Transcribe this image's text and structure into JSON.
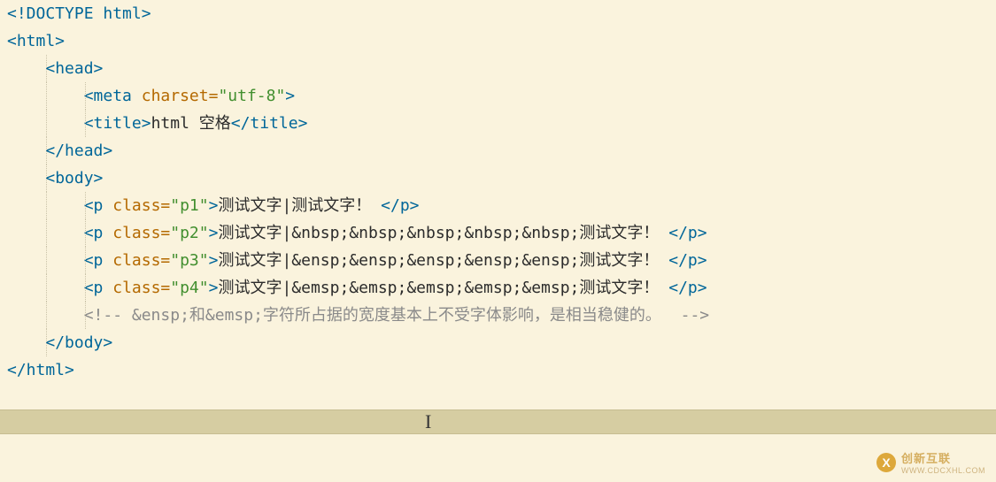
{
  "code": {
    "doctype": "<!DOCTYPE html>",
    "html_open": "<html>",
    "head_open": "<head>",
    "meta_open": "<meta",
    "meta_attr": " charset=",
    "meta_val": "\"utf-8\"",
    "meta_close": ">",
    "title_open": "<title>",
    "title_text": "html 空格",
    "title_close": "</title>",
    "head_close": "</head>",
    "body_open": "<body>",
    "p_open": "<p",
    "class_attr": " class=",
    "p_close_open": ">",
    "p_close": "</p>",
    "p1_val": "\"p1\"",
    "p1_text": "测试文字|测试文字！ ",
    "p2_val": "\"p2\"",
    "p2_text": "测试文字|&nbsp;&nbsp;&nbsp;&nbsp;&nbsp;测试文字！ ",
    "p3_val": "\"p3\"",
    "p3_text": "测试文字|&ensp;&ensp;&ensp;&ensp;&ensp;测试文字！ ",
    "p4_val": "\"p4\"",
    "p4_text": "测试文字|&emsp;&emsp;&emsp;&emsp;&emsp;测试文字！ ",
    "comment": "<!-- &ensp;和&emsp;字符所占据的宽度基本上不受字体影响，是相当稳健的。  -->",
    "body_close": "</body>",
    "html_close": "</html>"
  },
  "watermark": {
    "logo_letter": "X",
    "brand": "创新互联",
    "sub": "WWW.CDCXHL.COM"
  },
  "caret_glyph": "I"
}
